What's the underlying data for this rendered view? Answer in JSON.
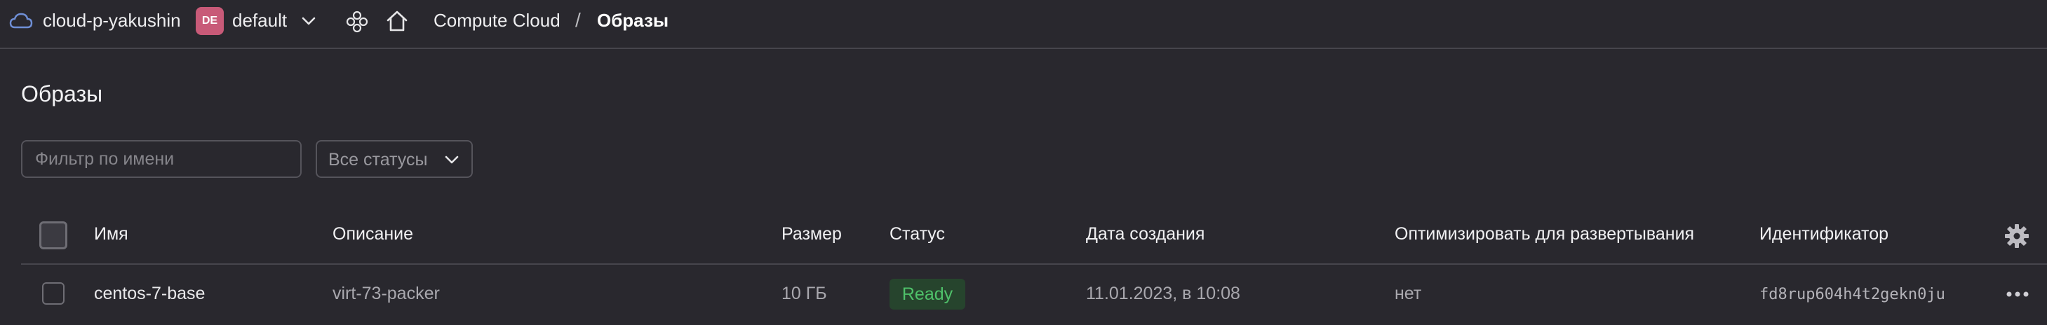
{
  "topbar": {
    "cloud_name": "cloud-p-yakushin",
    "folder_badge": "DE",
    "folder_name": "default",
    "breadcrumb": {
      "service": "Compute Cloud",
      "separator": "/",
      "current": "Образы"
    }
  },
  "page": {
    "title": "Образы"
  },
  "filters": {
    "name_placeholder": "Фильтр по имени",
    "status_value": "Все статусы"
  },
  "table": {
    "columns": {
      "name": "Имя",
      "description": "Описание",
      "size": "Размер",
      "status": "Статус",
      "created": "Дата создания",
      "optimize": "Оптимизировать для развертывания",
      "id": "Идентификатор"
    },
    "rows": [
      {
        "name": "centos-7-base",
        "description": "virt-73-packer",
        "size": "10 ГБ",
        "status": "Ready",
        "created": "11.01.2023, в 10:08",
        "optimize": "нет",
        "id": "fd8rup604h4t2gekn0ju"
      }
    ]
  },
  "colors": {
    "background": "#29282e",
    "folder_badge": "#c85a78",
    "status_ready_bg": "#26442d",
    "status_ready_text": "#4fc16a"
  },
  "icons": [
    "cloud-icon",
    "chevron-down-icon",
    "services-icon",
    "home-icon",
    "settings-gear-icon",
    "more-dots-icon"
  ]
}
